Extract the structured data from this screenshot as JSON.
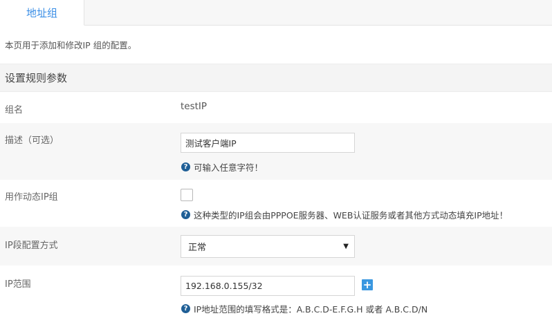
{
  "tabs": [
    {
      "label": "地址组",
      "active": true
    }
  ],
  "intro": "本页用于添加和修改IP 组的配置。",
  "section_title": "设置规则参数",
  "fields": {
    "group_name": {
      "label": "组名",
      "value": "testIP"
    },
    "description": {
      "label": "描述（可选）",
      "value": "测试客户端IP",
      "hint": "可输入任意字符！"
    },
    "dynamic": {
      "label": "用作动态IP组",
      "checked": false,
      "hint": "这种类型的IP组会由PPPOE服务器、WEB认证服务或者其他方式动态填充IP地址！"
    },
    "mode": {
      "label": "IP段配置方式",
      "selected": "正常"
    },
    "range": {
      "label": "IP范围",
      "value": "192.168.0.155/32",
      "hint": "IP地址范围的填写格式是：A.B.C.D-E.F.G.H 或者 A.B.C.D/N"
    }
  },
  "icons": {
    "help": "question-circle-icon",
    "add": "plus-icon",
    "dropdown": "caret-down-icon"
  },
  "colors": {
    "accent": "#3a8ee6",
    "help_icon": "#1f5f96",
    "add_button": "#3a97e0"
  }
}
